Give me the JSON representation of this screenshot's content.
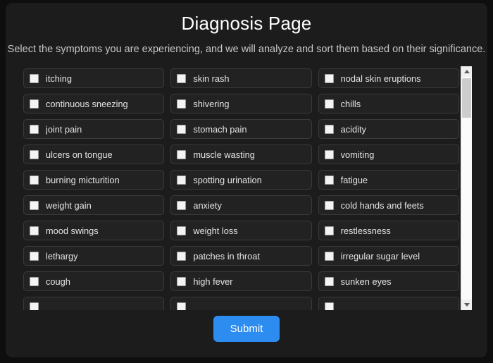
{
  "page": {
    "title": "Diagnosis Page",
    "subtitle": "Select the symptoms you are experiencing, and we will analyze and sort them based on their significance."
  },
  "colors": {
    "page_background": "#0e0e0e",
    "card_background": "#1c1c1c",
    "item_background": "#222222",
    "item_border": "#3a3a3a",
    "accent": "#2d8cf0",
    "text_primary": "#ffffff",
    "text_secondary": "#c8c8c8",
    "checkbox_fill": "#f4f4f4"
  },
  "symptoms": [
    {
      "label": "itching",
      "checked": false
    },
    {
      "label": "skin rash",
      "checked": false
    },
    {
      "label": "nodal skin eruptions",
      "checked": false
    },
    {
      "label": "continuous sneezing",
      "checked": false
    },
    {
      "label": "shivering",
      "checked": false
    },
    {
      "label": "chills",
      "checked": false
    },
    {
      "label": "joint pain",
      "checked": false
    },
    {
      "label": "stomach pain",
      "checked": false
    },
    {
      "label": "acidity",
      "checked": false
    },
    {
      "label": "ulcers on tongue",
      "checked": false
    },
    {
      "label": "muscle wasting",
      "checked": false
    },
    {
      "label": "vomiting",
      "checked": false
    },
    {
      "label": "burning micturition",
      "checked": false
    },
    {
      "label": "spotting urination",
      "checked": false
    },
    {
      "label": "fatigue",
      "checked": false
    },
    {
      "label": "weight gain",
      "checked": false
    },
    {
      "label": "anxiety",
      "checked": false
    },
    {
      "label": "cold hands and feets",
      "checked": false
    },
    {
      "label": "mood swings",
      "checked": false
    },
    {
      "label": "weight loss",
      "checked": false
    },
    {
      "label": "restlessness",
      "checked": false
    },
    {
      "label": "lethargy",
      "checked": false
    },
    {
      "label": "patches in throat",
      "checked": false
    },
    {
      "label": "irregular sugar level",
      "checked": false
    },
    {
      "label": "cough",
      "checked": false
    },
    {
      "label": "high fever",
      "checked": false
    },
    {
      "label": "sunken eyes",
      "checked": false
    },
    {
      "label": "",
      "checked": false
    },
    {
      "label": "",
      "checked": false
    },
    {
      "label": "",
      "checked": false
    }
  ],
  "scrollbar": {
    "up_arrow_icon": "triangle-up-icon",
    "down_arrow_icon": "triangle-down-icon",
    "thumb_position": "top"
  },
  "submit": {
    "label": "Submit"
  }
}
